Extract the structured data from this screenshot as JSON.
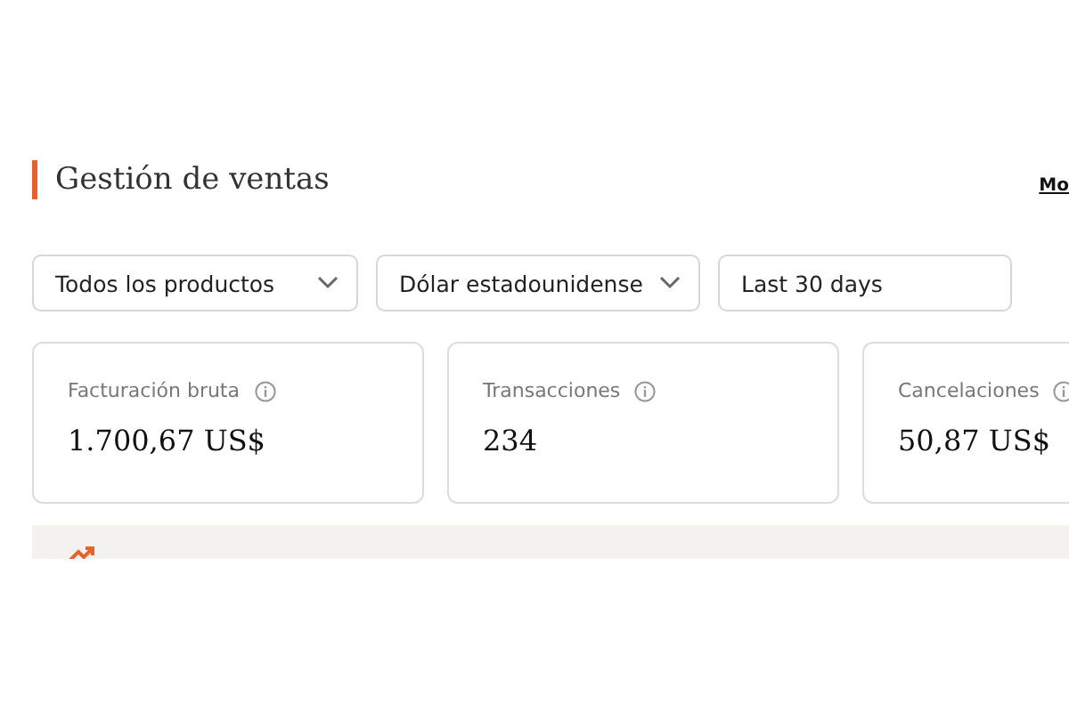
{
  "header": {
    "title": "Gestión de ventas",
    "link": "Mo"
  },
  "filters": [
    {
      "kind": "dropdown",
      "value": "Todos los productos"
    },
    {
      "kind": "dropdown",
      "value": "Dólar estadounidense"
    },
    {
      "kind": "field",
      "value": "Last 30 days"
    }
  ],
  "metrics": [
    {
      "label": "Facturación bruta",
      "value": "1.700,67 US$"
    },
    {
      "label": "Transacciones",
      "value": "234"
    },
    {
      "label": "Cancelaciones",
      "value": "50,87 US$"
    }
  ]
}
